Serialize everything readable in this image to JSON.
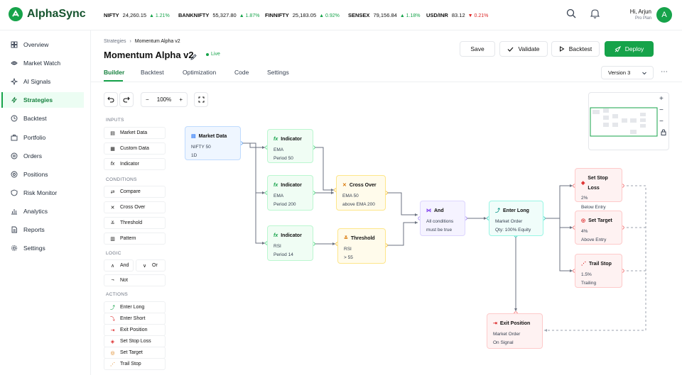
{
  "brand": {
    "name": "AlphaSync",
    "color": "#16a34a"
  },
  "tickers": [
    {
      "sym": "NIFTY",
      "val": "24,260.15",
      "chg": "▲ 1.21%",
      "dir": "up"
    },
    {
      "sym": "BANKNIFTY",
      "val": "55,327.80",
      "chg": "▲ 1.87%",
      "dir": "up"
    },
    {
      "sym": "FINNIFTY",
      "val": "25,183.05",
      "chg": "▲ 0.92%",
      "dir": "up"
    },
    {
      "sym": "SENSEX",
      "val": "79,156.84",
      "chg": "▲ 1.18%",
      "dir": "up"
    },
    {
      "sym": "USD/INR",
      "val": "83.12",
      "chg": "▼ 0.21%",
      "dir": "down"
    }
  ],
  "user": {
    "greeting": "Hi, Arjun",
    "plan": "Pro Plan",
    "initial": "A"
  },
  "nav": [
    {
      "label": "Overview",
      "icon": "grid-icon"
    },
    {
      "label": "Market Watch",
      "icon": "eye-icon"
    },
    {
      "label": "AI Signals",
      "icon": "sparkle-icon"
    },
    {
      "label": "Strategies",
      "icon": "bolt-icon",
      "active": true
    },
    {
      "label": "Backtest",
      "icon": "clock-icon"
    },
    {
      "label": "Portfolio",
      "icon": "briefcase-icon"
    },
    {
      "label": "Orders",
      "icon": "list-icon"
    },
    {
      "label": "Positions",
      "icon": "target-icon"
    },
    {
      "label": "Risk Monitor",
      "icon": "shield-icon"
    },
    {
      "label": "Analytics",
      "icon": "bar-chart-icon"
    },
    {
      "label": "Reports",
      "icon": "file-icon"
    },
    {
      "label": "Settings",
      "icon": "gear-icon"
    }
  ],
  "breadcrumb": {
    "root": "Strategies",
    "sep": "›",
    "current": "Momentum Alpha v2"
  },
  "title": "Momentum Alpha v2",
  "status": "Live",
  "actions": {
    "save": "Save",
    "validate": "Validate",
    "backtest": "Backtest",
    "deploy": "Deploy"
  },
  "tabs": [
    "Builder",
    "Backtest",
    "Optimization",
    "Code",
    "Settings"
  ],
  "version": "Version 3",
  "zoom": "100%",
  "palette": {
    "inputs_title": "INPUTS",
    "inputs": [
      "Market Data",
      "Custom Data",
      "Indicator"
    ],
    "conditions_title": "CONDITIONS",
    "conditions": [
      "Compare",
      "Cross Over",
      "Threshold",
      "Pattern"
    ],
    "logic_title": "LOGIC",
    "logic": [
      "And",
      "Or",
      "Not"
    ],
    "actions_title": "ACTIONS",
    "actions": [
      "Enter Long",
      "Enter Short",
      "Exit Position",
      "Set Stop Loss",
      "Set Target",
      "Trail Stop"
    ]
  },
  "nodes": {
    "market": {
      "title": "Market Data",
      "l1": "NIFTY 50",
      "l2": "1D"
    },
    "ind1": {
      "title": "Indicator",
      "l1": "EMA",
      "l2": "Period 50"
    },
    "ind2": {
      "title": "Indicator",
      "l1": "EMA",
      "l2": "Period 200"
    },
    "ind3": {
      "title": "Indicator",
      "l1": "RSI",
      "l2": "Period 14"
    },
    "cross": {
      "title": "Cross Over",
      "l1": "EMA 50",
      "l2": "above EMA 200"
    },
    "thresh": {
      "title": "Threshold",
      "l1": "RSI",
      "l2": "> 55"
    },
    "and": {
      "title": "And",
      "l1": "All conditions",
      "l2": "must be true"
    },
    "enter": {
      "title": "Enter Long",
      "l1": "Market Order",
      "l2": "Qty: 100% Equity"
    },
    "sl": {
      "title": "Set Stop Loss",
      "l1": "2%",
      "l2": "Below Entry"
    },
    "tgt": {
      "title": "Set Target",
      "l1": "4%",
      "l2": "Above Entry"
    },
    "trail": {
      "title": "Trail Stop",
      "l1": "1.5%",
      "l2": "Trailing"
    },
    "exit": {
      "title": "Exit Position",
      "l1": "Market Order",
      "l2": "On Signal"
    }
  }
}
